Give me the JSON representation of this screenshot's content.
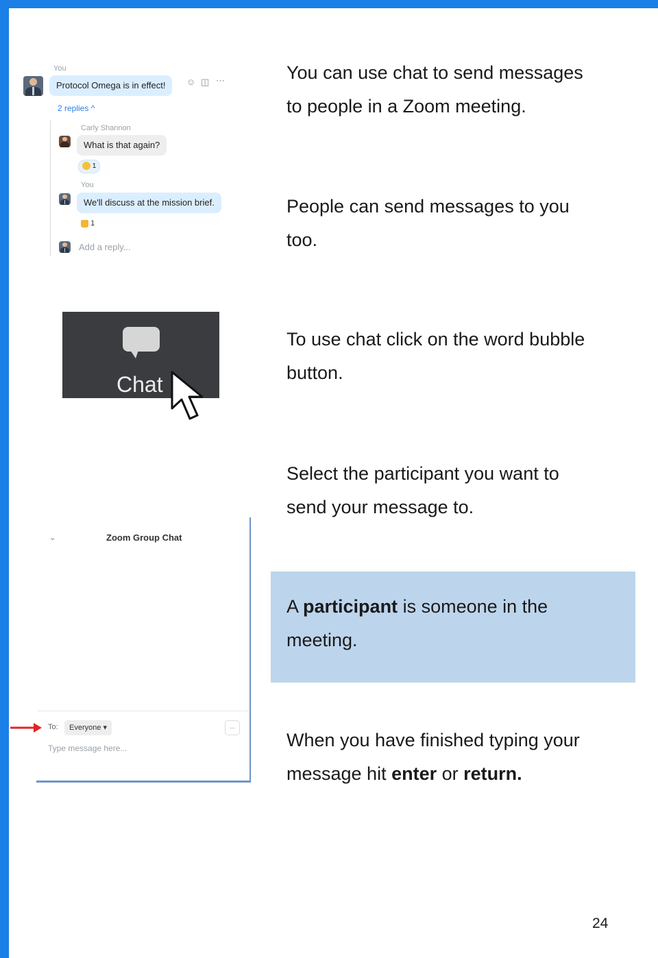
{
  "page": {
    "number": "24",
    "frame_color": "#1a7fe6",
    "note_bg": "#bdd5ec"
  },
  "paragraphs": {
    "p1_line1": "You can use chat to send messages",
    "p1_line2": "to people in a Zoom meeting.",
    "p2_line1": "People can send messages to you",
    "p2_line2": "too.",
    "p3_line1": "To use chat click on the word bubble",
    "p3_line2": "button.",
    "p4_line1": "Select the participant you want to",
    "p4_line2": "send your message to.",
    "note_pre": "A ",
    "note_bold": "participant",
    "note_post": " is someone in the",
    "note_line2": "meeting.",
    "p5_line1": "When you have finished typing your",
    "p5_pre": "message hit ",
    "p5_bold1": "enter",
    "p5_mid": " or ",
    "p5_bold2": "return."
  },
  "thread": {
    "sender1": "You",
    "message1": "Protocol Omega is in effect!",
    "replies_link": "2 replies ^",
    "sender2": "Carly Shannon",
    "message2": "What is that again?",
    "reaction2_count": "1",
    "sender3": "You",
    "message3": "We'll discuss at the mission brief.",
    "reaction3_count": "1",
    "reply_placeholder": "Add a reply..."
  },
  "chat_button": {
    "label": "Chat"
  },
  "group_chat": {
    "title": "Zoom Group Chat",
    "to_label": "To:",
    "recipient": "Everyone",
    "input_placeholder": "Type message here...",
    "more_label": "...",
    "arrow_color": "#e52424"
  }
}
